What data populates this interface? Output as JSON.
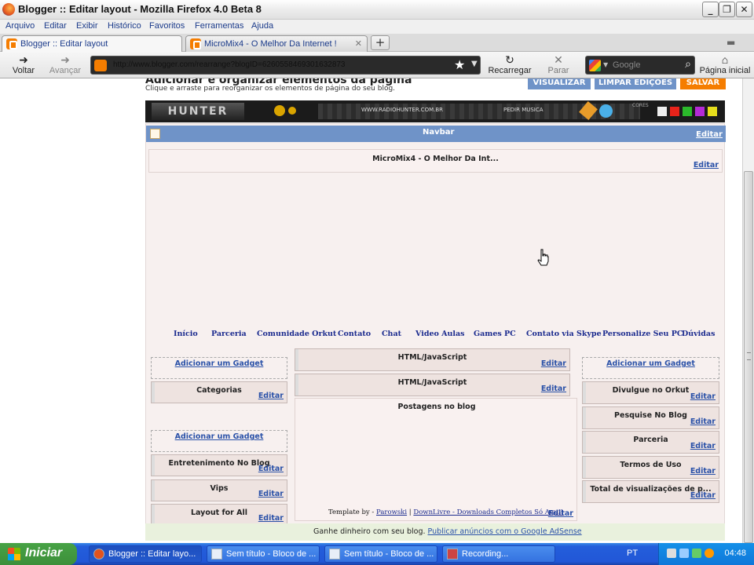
{
  "window": {
    "title": "Blogger :: Editar layout - Mozilla Firefox 4.0 Beta 8"
  },
  "menu": [
    "Arquivo",
    "Editar",
    "Exibir",
    "Histórico",
    "Favoritos",
    "Ferramentas",
    "Ajuda"
  ],
  "tabs": [
    {
      "label": "Blogger :: Editar layout",
      "active": true
    },
    {
      "label": "MicroMix4 - O Melhor Da Internet !",
      "active": false
    }
  ],
  "nav": {
    "back": "Voltar",
    "forward": "Avançar",
    "url": "http://www.blogger.com/rearrange?blogID=6260558469301632873",
    "reload": "Recarregar",
    "stop": "Parar",
    "search_placeholder": "Google",
    "home": "Página inicial"
  },
  "page": {
    "heading": "Adicionar e organizar elementos da página",
    "subheading": "Clique e arraste para reorganizar os elementos de página do seu blog.",
    "buttons": {
      "preview": "VISUALIZAR",
      "clear": "LIMPAR EDIÇÕES",
      "save": "SALVAR"
    },
    "radio": {
      "url": "WWW.RADIOHUNTER.COM.BR",
      "request": "PEDIR MUSICA",
      "colors": "CORES"
    },
    "navbar_label": "Navbar",
    "edit": "Editar",
    "add_gadget": "Adicionar um Gadget",
    "header_title": "MicroMix4 - O Melhor Da Int...",
    "nav_links": [
      "Início",
      "Parceria",
      "Comunidade Orkut",
      "Contato",
      "Chat",
      "Video Aulas",
      "Games PC",
      "Contato via Skype",
      "Personalize Seu PC",
      "Dúvidas"
    ],
    "left_gadgets_1": [
      "Categorias"
    ],
    "left_gadgets_2": [
      "Entretenimento No Blog",
      "Vips",
      "Layout for All"
    ],
    "main_gadgets": [
      "HTML/JavaScript",
      "HTML/JavaScript"
    ],
    "blog_posts": "Postagens no blog",
    "right_gadgets": [
      "Divulgue no Orkut",
      "Pesquise No Blog",
      "Parceria",
      "Termos de Uso",
      "Total de visualizações de p..."
    ],
    "footer": {
      "prefix": "Template by - ",
      "link1": "Parowski",
      "sep": " | ",
      "link2": "DownLivre - Downloads Completos Só Aqui!"
    },
    "adsense": {
      "text": "Ganhe dinheiro com seu blog.",
      "link": "Publicar anúncios com o Google AdSense"
    }
  },
  "taskbar": {
    "start": "Iniciar",
    "tasks": [
      "Blogger :: Editar layo...",
      "Sem título - Bloco de ...",
      "Sem título - Bloco de ...",
      "Recording..."
    ],
    "lang": "PT",
    "clock": "04:48"
  },
  "colors": {
    "navbar_blue": "#6f93c8",
    "preview_btn": "#6f93c8",
    "clear_btn": "#6f93c8",
    "save_btn": "#f57d00",
    "link_blue": "#2a51a8",
    "layout_bg": "#f7f0ef",
    "adsense_bg": "#e9f1dd"
  }
}
